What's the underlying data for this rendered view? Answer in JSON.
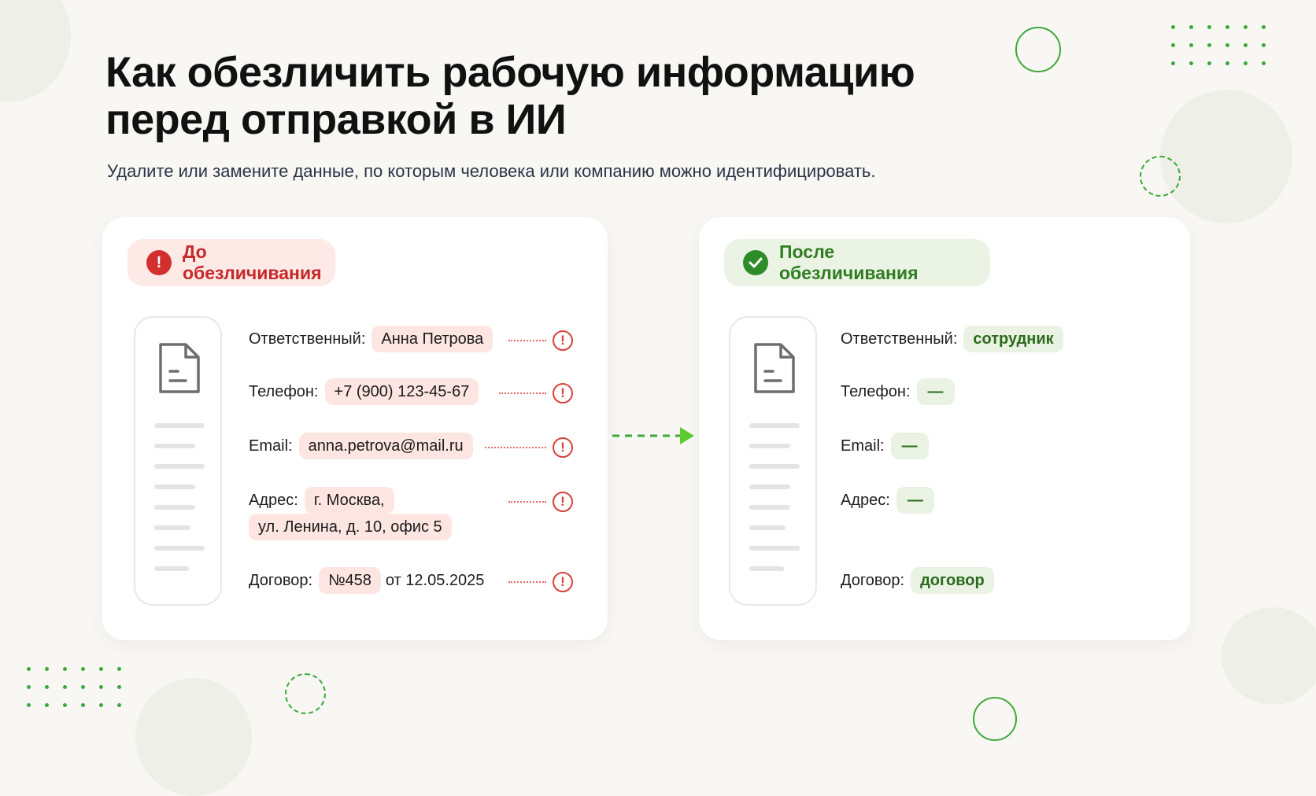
{
  "title_line1": "Как обезличить рабочую информацию",
  "title_line2": "перед отправкой в ИИ",
  "subtitle": "Удалите или замените данные, по которым человека или компанию можно идентифицировать.",
  "before": {
    "badge_label": "До обезличивания",
    "badge_icon": "exclamation-icon",
    "rows": {
      "responsible": {
        "label": "Ответственный:",
        "value": "Анна Петрова"
      },
      "phone": {
        "label": "Телефон:",
        "value": "+7 (900) 123-45-67"
      },
      "email": {
        "label": "Email:",
        "value": "anna.petrova@mail.ru"
      },
      "address": {
        "label": "Адрес:",
        "value_line1": "г. Москва,",
        "value_line2": "ул. Ленина, д. 10, офис 5"
      },
      "contract": {
        "label": "Договор:",
        "value": "№458",
        "suffix": "от 12.05.2025"
      }
    },
    "warn_glyph": "!"
  },
  "after": {
    "badge_label": "После обезличивания",
    "badge_icon": "check-icon",
    "rows": {
      "responsible": {
        "label": "Ответственный:",
        "value": "сотрудник"
      },
      "phone": {
        "label": "Телефон:",
        "value": "—"
      },
      "email": {
        "label": "Email:",
        "value": "—"
      },
      "address": {
        "label": "Адрес:",
        "value": "—"
      },
      "contract": {
        "label": "Договор:",
        "value": "договор"
      }
    }
  },
  "colors": {
    "accent_green": "#3fa83a",
    "alert_red": "#d32f2f",
    "background": "#f8f7f4"
  }
}
